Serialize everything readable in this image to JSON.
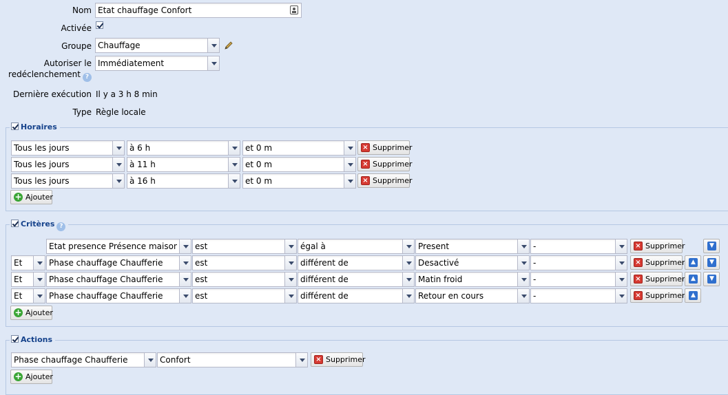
{
  "form": {
    "name_label": "Nom",
    "name_value": "Etat chauffage Confort",
    "enabled_label": "Activée",
    "group_label": "Groupe",
    "group_value": "Chauffage",
    "retrigger_label_line1": "Autoriser le",
    "retrigger_label_line2": "redéclenchement",
    "retrigger_value": "Immédiatement",
    "last_exec_label": "Dernière exécution",
    "last_exec_value": "Il y a 3 h 8 min",
    "type_label": "Type",
    "type_value": "Règle locale"
  },
  "horaires": {
    "legend": "Horaires",
    "rows": [
      {
        "day": "Tous les jours",
        "hour": "à 6 h",
        "minute": "et 0 m"
      },
      {
        "day": "Tous les jours",
        "hour": "à 11 h",
        "minute": "et 0 m"
      },
      {
        "day": "Tous les jours",
        "hour": "à 16 h",
        "minute": "et 0 m"
      }
    ],
    "delete_label": "Supprimer",
    "add_label": "Ajouter"
  },
  "criteres": {
    "legend": "Critères",
    "rows": [
      {
        "op": "",
        "device": "Etat presence Présence maison",
        "verb": "est",
        "cmp": "égal à",
        "value": "Present",
        "extra": "-"
      },
      {
        "op": "Et",
        "device": "Phase chauffage Chaufferie",
        "verb": "est",
        "cmp": "différent de",
        "value": "Desactivé",
        "extra": "-"
      },
      {
        "op": "Et",
        "device": "Phase chauffage Chaufferie",
        "verb": "est",
        "cmp": "différent de",
        "value": "Matin froid",
        "extra": "-"
      },
      {
        "op": "Et",
        "device": "Phase chauffage Chaufferie",
        "verb": "est",
        "cmp": "différent de",
        "value": "Retour en cours",
        "extra": "-"
      }
    ],
    "delete_label": "Supprimer",
    "add_label": "Ajouter"
  },
  "actions": {
    "legend": "Actions",
    "rows": [
      {
        "device": "Phase chauffage Chaufferie",
        "value": "Confort"
      }
    ],
    "delete_label": "Supprimer",
    "add_label": "Ajouter"
  },
  "icons": {
    "delete": "delete-icon",
    "add": "add-icon",
    "up": "arrow-up-icon",
    "down": "arrow-down-icon",
    "edit": "pencil-icon",
    "help": "help-icon",
    "contact": "contact-card-icon"
  },
  "colors": {
    "background": "#dfe8f6",
    "legend": "#15428b",
    "border": "#b5b8c8"
  }
}
